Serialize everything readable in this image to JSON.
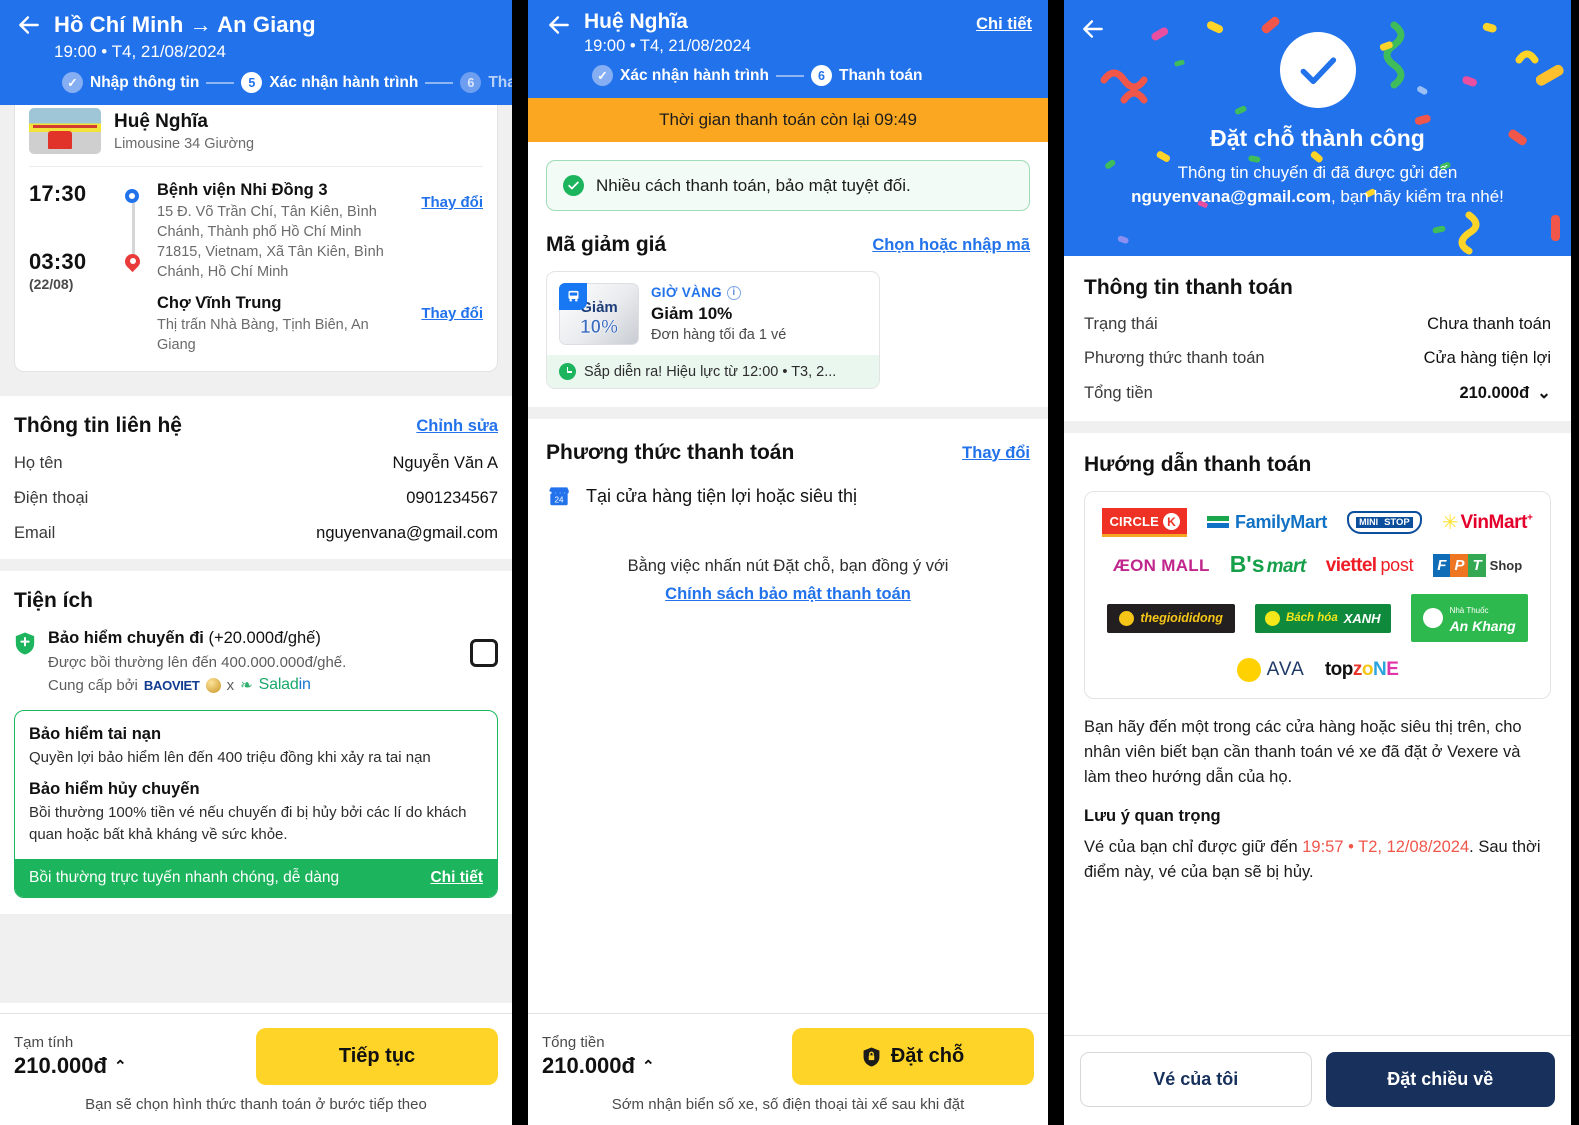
{
  "panel1": {
    "header": {
      "back_icon": "arrow-left-icon",
      "title": "Hồ Chí Minh → An Giang",
      "subtitle": "19:00 • T4, 21/08/2024",
      "steps": [
        {
          "badge": "✓",
          "label": "Nhập thông tin",
          "state": "done"
        },
        {
          "badge": "5",
          "label": "Xác nhận hành trình",
          "state": "active"
        },
        {
          "badge": "6",
          "label": "Thanh toán",
          "state": "next"
        }
      ]
    },
    "trip": {
      "thumb_icon": "bus-photo",
      "operator": "Huệ Nghĩa",
      "vehicle": "Limousine 34 Giường",
      "stops": [
        {
          "time": "17:30",
          "date": "",
          "name": "Bệnh viện Nhi Đồng 3",
          "address": "15 Đ. Võ Trần Chí, Tân Kiên, Bình Chánh, Thành phố Hồ Chí Minh 71815, Vietnam, Xã Tân Kiên, Bình Chánh, Hồ Chí Minh",
          "change_label": "Thay đổi"
        },
        {
          "time": "03:30",
          "date": "(22/08)",
          "name": "Chợ Vĩnh Trung",
          "address": "Thị trấn Nhà Bàng, Tịnh Biên, An Giang",
          "change_label": "Thay đổi"
        }
      ]
    },
    "contact": {
      "title": "Thông tin liên hệ",
      "edit_label": "Chỉnh sửa",
      "rows": [
        {
          "key": "Họ tên",
          "value": "Nguyễn Văn A"
        },
        {
          "key": "Điện thoại",
          "value": "0901234567"
        },
        {
          "key": "Email",
          "value": "nguyenvana@gmail.com"
        }
      ]
    },
    "utilities": {
      "title": "Tiện ích",
      "insurance": {
        "icon": "shield-icon",
        "title_bold": "Bảo hiểm chuyến đi",
        "title_price": "(+20.000đ/ghế)",
        "note": "Được bồi thường lên đến 400.000.000đ/ghế.",
        "provider_prefix": "Cung cấp bởi",
        "provider_1": "BAOVIET",
        "provider_x": "x",
        "provider_2": "Salad",
        "provider_2_suffix": "in",
        "checkbox_checked": false
      },
      "benefits": [
        {
          "heading": "Bảo hiểm tai nạn",
          "text": "Quyền lợi bảo hiểm lên đến 400 triệu đồng khi xảy ra tai nạn"
        },
        {
          "heading": "Bảo hiểm hủy chuyến",
          "text": "Bồi thường 100% tiền vé nếu chuyến đi bị hủy bởi các lí do khách quan hoặc bất khả kháng về sức khỏe."
        }
      ],
      "footer_text": "Bồi thường trực tuyến nhanh chóng, dễ dàng",
      "footer_link": "Chi tiết"
    },
    "footer": {
      "price_label": "Tạm tính",
      "price_value": "210.000đ",
      "caret": "⌃",
      "cta": "Tiếp tục",
      "note": "Bạn sẽ chọn hình thức thanh toán ở bước tiếp theo"
    }
  },
  "panel2": {
    "header": {
      "back_icon": "arrow-left-icon",
      "title": "Huệ Nghĩa",
      "subtitle": "19:00 • T4, 21/08/2024",
      "detail_link": "Chi tiết",
      "steps": [
        {
          "badge": "✓",
          "label": "Xác nhận hành trình",
          "state": "done"
        },
        {
          "badge": "6",
          "label": "Thanh toán",
          "state": "active"
        }
      ]
    },
    "timer": "Thời gian thanh toán còn lại 09:49",
    "notice": {
      "icon": "shield-check-icon",
      "text": "Nhiều cách thanh toán, bảo mật tuyệt đối."
    },
    "promo": {
      "title": "Mã giảm giá",
      "link": "Chọn hoặc nhập mã",
      "voucher": {
        "thumb_icon": "bus-icon",
        "thumb_line1": "Giảm",
        "thumb_line2": "10%",
        "kind": "GIỜ VÀNG",
        "info_icon": "info-icon",
        "name": "Giảm 10%",
        "condition": "Đơn hàng tối đa 1 vé",
        "status_icon": "clock-icon",
        "status": "Sắp diễn ra! Hiệu lực từ 12:00 • T3, 2..."
      }
    },
    "payment": {
      "title": "Phương thức thanh toán",
      "change_link": "Thay đổi",
      "method_icon": "store-24h-icon",
      "method": "Tại cửa hàng tiện lợi hoặc siêu thị",
      "agree_text": "Bằng việc nhấn nút Đặt chỗ, bạn đồng ý với",
      "agree_link": "Chính sách bảo mật thanh toán"
    },
    "footer": {
      "price_label": "Tổng tiền",
      "price_value": "210.000đ",
      "caret": "⌃",
      "cta_icon": "lock-shield-icon",
      "cta": "Đặt chỗ",
      "note": "Sớm nhận biển số xe, số điện thoại tài xế sau khi đặt"
    }
  },
  "panel3": {
    "header": {
      "back_icon": "arrow-left-icon",
      "check_icon": "check-circle-icon",
      "title": "Đặt chỗ thành công",
      "line1": "Thông tin chuyến đi đã được gửi đến",
      "email": "nguyenvana@gmail.com",
      "line2": ", bạn hãy kiểm tra nhé!"
    },
    "payment_info": {
      "title": "Thông tin thanh toán",
      "rows": [
        {
          "key": "Trạng thái",
          "value": "Chưa thanh toán",
          "style": "red"
        },
        {
          "key": "Phương thức thanh toán",
          "value": "Cửa hàng tiện lợi",
          "style": "normal"
        },
        {
          "key": "Tổng tiền",
          "value": "210.000đ",
          "style": "bold",
          "caret": "⌄"
        }
      ]
    },
    "guide": {
      "title": "Hướng dẫn thanh toán",
      "stores": [
        [
          "Circle K",
          "FamilyMart",
          "MINI STOP",
          "VinMart"
        ],
        [
          "ÆON MALL",
          "B's mart",
          "viettel post",
          "FPT Shop"
        ],
        [
          "thegioididong",
          "Bách hóa XANH",
          "Nhà Thuốc An Khang"
        ],
        [
          "AVA",
          "topzone"
        ]
      ],
      "body": "Bạn hãy đến một trong các cửa hàng hoặc siêu thị trên, cho nhân viên biết bạn cần thanh toán vé xe đã đặt ở Vexere và làm theo hướng dẫn của họ.",
      "note_title": "Lưu ý quan trọng",
      "note_pre": "Vé của bạn chỉ được giữ đến ",
      "note_time": "19:57 • T2, 12/08/2024",
      "note_post": ". Sau thời điểm này, vé của bạn sẽ bị hủy."
    },
    "footer": {
      "secondary": "Vé của tôi",
      "primary": "Đặt chiều về"
    }
  },
  "colors": {
    "brand_blue": "#2272eb",
    "accent_yellow": "#ffd429",
    "success_green": "#1cb45c",
    "warn_orange": "#fba721",
    "danger_red": "#f0564a",
    "navy": "#17305c"
  }
}
